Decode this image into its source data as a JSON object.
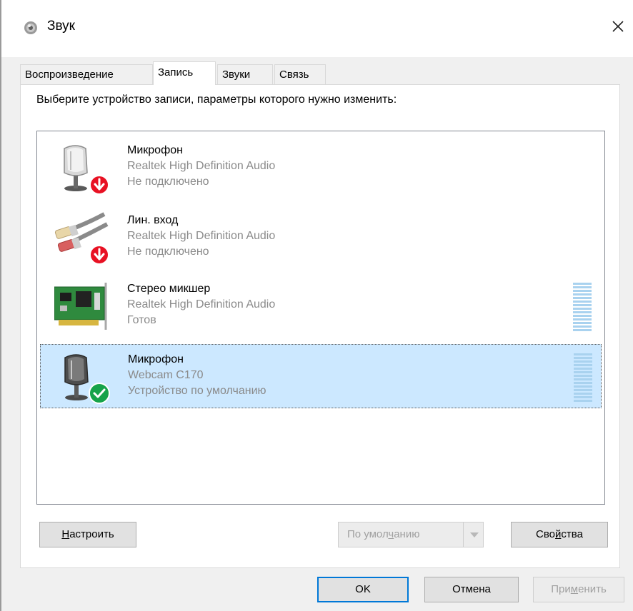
{
  "window": {
    "title": "Звук",
    "icon": "speaker-icon",
    "close_label": "×"
  },
  "tabs": [
    {
      "label": "Воспроизведение",
      "active": false
    },
    {
      "label": "Запись",
      "active": true
    },
    {
      "label": "Звуки",
      "active": false
    },
    {
      "label": "Связь",
      "active": false
    }
  ],
  "panel": {
    "instruction": "Выберите устройство записи, параметры которого нужно изменить:"
  },
  "devices": [
    {
      "name": "Микрофон",
      "driver": "Realtek High Definition Audio",
      "status": "Не подключено",
      "icon": "microphone-icon",
      "badge": "disconnected-badge-icon",
      "selected": false,
      "level_meter": false
    },
    {
      "name": "Лин. вход",
      "driver": "Realtek High Definition Audio",
      "status": "Не подключено",
      "icon": "line-in-cable-icon",
      "badge": "disconnected-badge-icon",
      "selected": false,
      "level_meter": false
    },
    {
      "name": "Стерео микшер",
      "driver": "Realtek High Definition Audio",
      "status": "Готов",
      "icon": "sound-card-icon",
      "badge": "",
      "selected": false,
      "level_meter": true
    },
    {
      "name": "Микрофон",
      "driver": "Webcam C170",
      "status": "Устройство по умолчанию",
      "icon": "microphone-icon",
      "badge": "default-check-badge-icon",
      "selected": true,
      "level_meter": true
    }
  ],
  "buttons": {
    "configure_pre": "",
    "configure_mnemonic": "Н",
    "configure_post": "астроить",
    "default_pre": "По умол",
    "default_mnemonic": "ч",
    "default_post": "анию",
    "properties_pre": "Сво",
    "properties_mnemonic": "й",
    "properties_post": "ства",
    "ok": "OK",
    "cancel": "Отмена",
    "apply_pre": "При",
    "apply_mnemonic": "м",
    "apply_post": "енить"
  },
  "colors": {
    "selection": "#cce8ff",
    "accent": "#0078d7",
    "disconnected_badge": "#e81123",
    "default_badge": "#16a34a",
    "level_meter": "#a9d2ef"
  }
}
